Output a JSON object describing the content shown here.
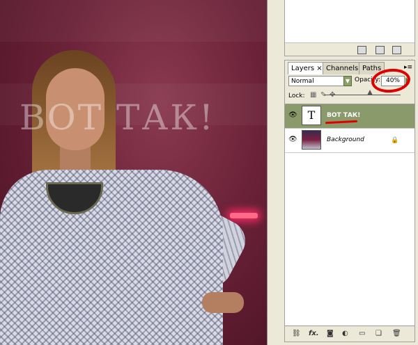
{
  "canvas": {
    "overlay_text": "ВОТ ТАК!"
  },
  "layers_panel": {
    "tabs": [
      {
        "label": "Layers",
        "active": true
      },
      {
        "label": "Channels",
        "active": false
      },
      {
        "label": "Paths",
        "active": false
      }
    ],
    "blend_mode": "Normal",
    "opacity_label": "Opacity:",
    "opacity_value": "40%",
    "lock_label": "Lock:",
    "layers": [
      {
        "name": "ВОТ ТАК!",
        "type": "text",
        "selected": true,
        "thumb_glyph": "T"
      },
      {
        "name": "Background",
        "type": "image",
        "selected": false,
        "locked": true
      }
    ],
    "bottom_icons": [
      "link-icon",
      "fx-icon",
      "mask-icon",
      "adjustment-icon",
      "folder-icon",
      "new-layer-icon",
      "trash-icon"
    ],
    "fx_label": "fx."
  },
  "colors": {
    "selected_row": "#8b9a6a",
    "annotation_red": "#e10000"
  }
}
